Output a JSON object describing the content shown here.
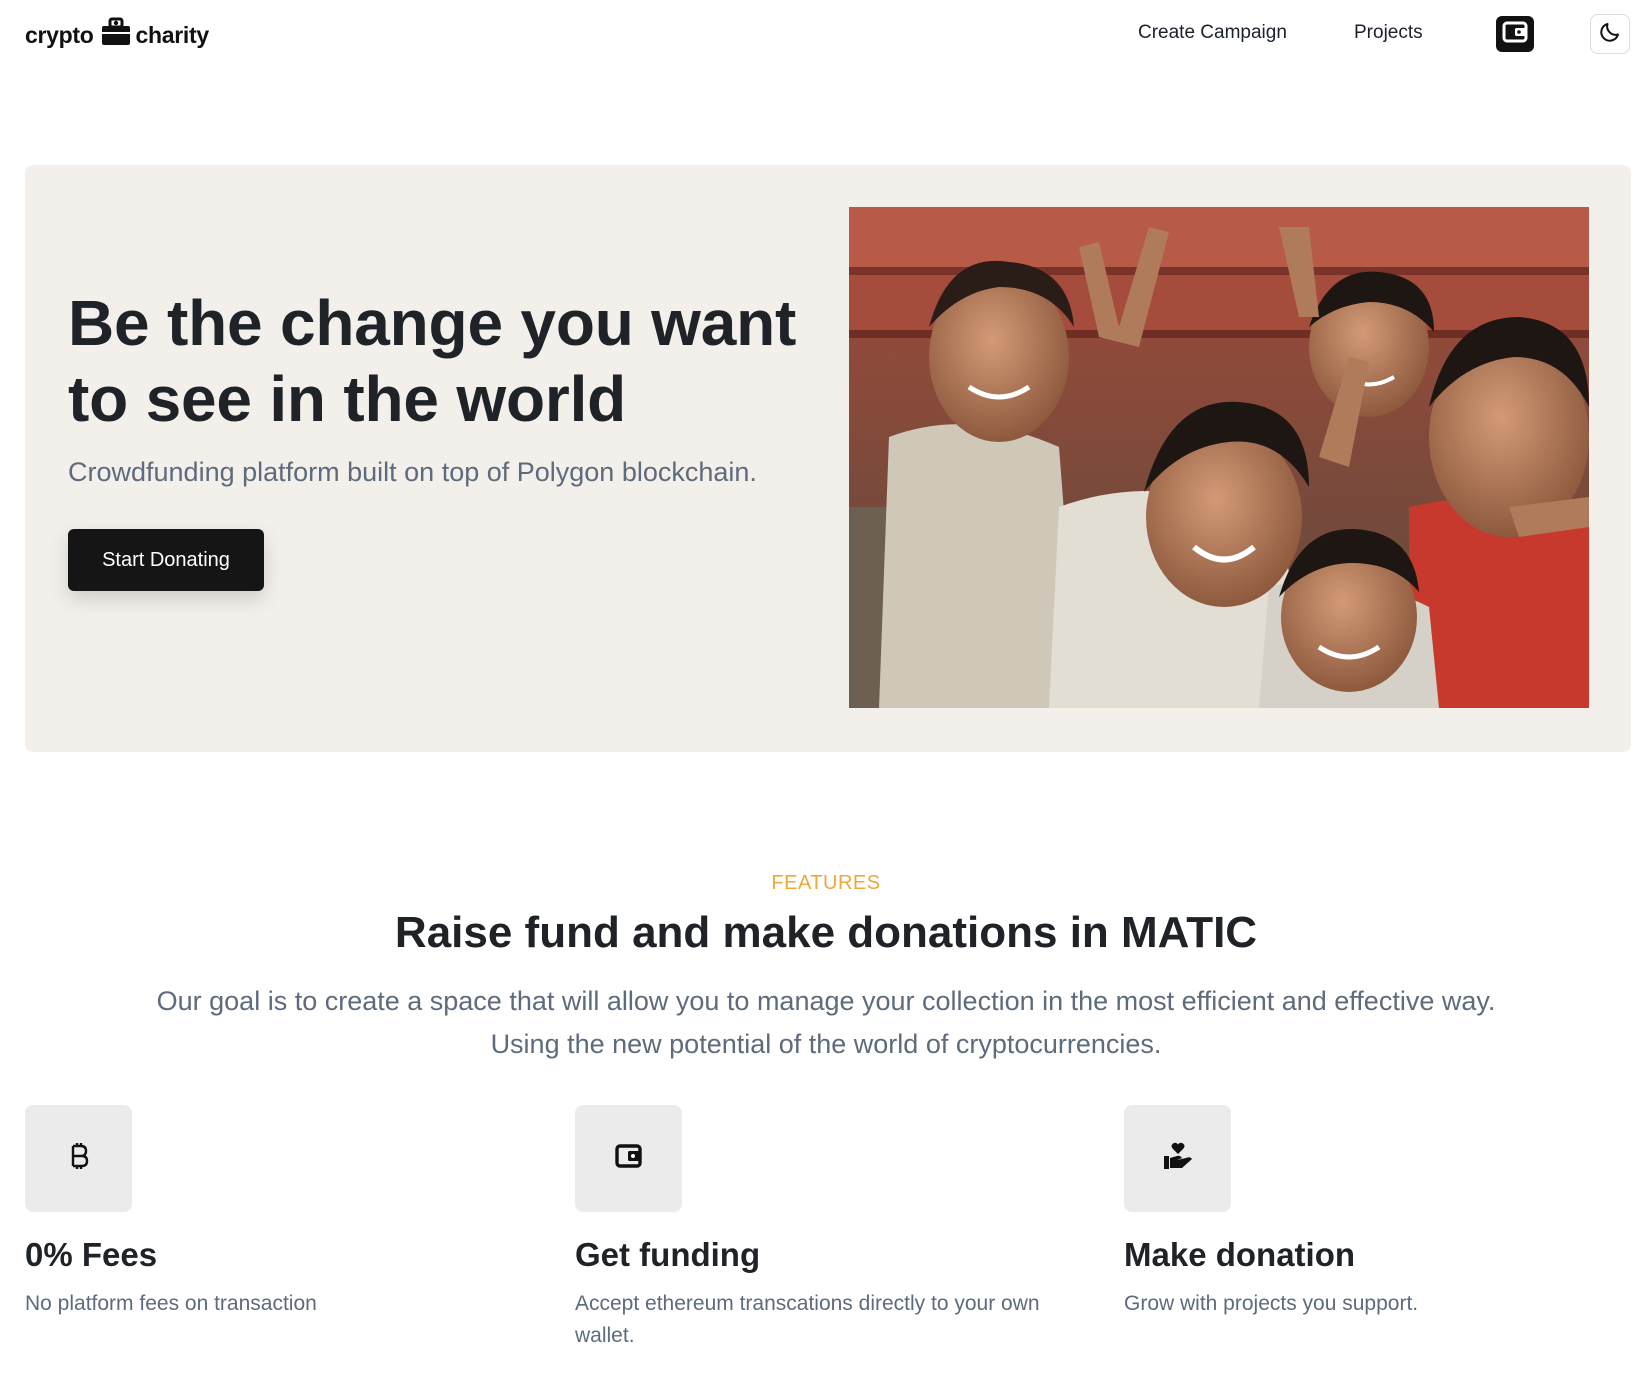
{
  "brand": {
    "left": "crypto",
    "right": "charity"
  },
  "nav": {
    "create_campaign": "Create Campaign",
    "projects": "Projects"
  },
  "hero": {
    "title": "Be the change you want to see in the world",
    "subtitle": "Crowdfunding platform built on top of Polygon blockchain.",
    "cta": "Start Donating",
    "image_icon": "children-photo"
  },
  "features": {
    "eyebrow": "FEATURES",
    "title": "Raise fund and make donations in MATIC",
    "description_line1": "Our goal is to create a space that will allow you to manage your collection in the most efficient and effective way.",
    "description_line2": "Using the new potential of the world of cryptocurrencies.",
    "items": [
      {
        "icon": "bitcoin-icon",
        "title": "0% Fees",
        "text": "No platform fees on transaction"
      },
      {
        "icon": "wallet-icon",
        "title": "Get funding",
        "text": "Accept ethereum transcations directly to your own wallet."
      },
      {
        "icon": "hand-heart-icon",
        "title": "Make donation",
        "text": "Grow with projects you support."
      }
    ]
  },
  "colors": {
    "accent": "#eda837",
    "hero_bg": "#f3efeb",
    "button_bg": "#151515",
    "muted_text": "#5e6b7c"
  }
}
